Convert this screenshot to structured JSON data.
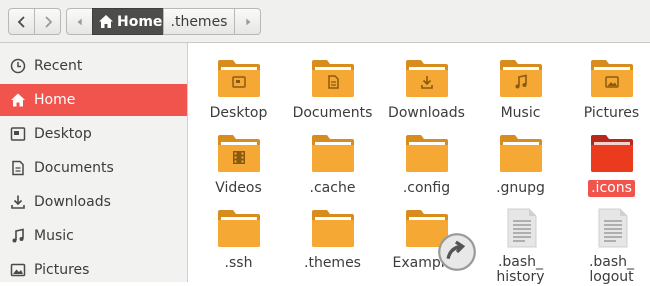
{
  "header": {
    "path": [
      {
        "label": "Home",
        "icon": "home-icon",
        "active": true
      },
      {
        "label": ".themes",
        "active": false
      }
    ]
  },
  "sidebar": {
    "items": [
      {
        "label": "Recent",
        "icon": "clock-icon"
      },
      {
        "label": "Home",
        "icon": "home-icon",
        "active": true
      },
      {
        "label": "Desktop",
        "icon": "desktop-icon"
      },
      {
        "label": "Documents",
        "icon": "document-icon"
      },
      {
        "label": "Downloads",
        "icon": "download-icon"
      },
      {
        "label": "Music",
        "icon": "music-icon"
      },
      {
        "label": "Pictures",
        "icon": "picture-icon"
      }
    ]
  },
  "files": [
    {
      "label": "Desktop",
      "type": "folder",
      "emblem": "desktop-icon"
    },
    {
      "label": "Documents",
      "type": "folder",
      "emblem": "document-icon"
    },
    {
      "label": "Downloads",
      "type": "folder",
      "emblem": "download-icon"
    },
    {
      "label": "Music",
      "type": "folder",
      "emblem": "music-icon"
    },
    {
      "label": "Pictures",
      "type": "folder",
      "emblem": "picture-icon"
    },
    {
      "label": "Videos",
      "type": "folder",
      "emblem": "film-icon"
    },
    {
      "label": ".cache",
      "type": "folder"
    },
    {
      "label": ".config",
      "type": "folder"
    },
    {
      "label": ".gnupg",
      "type": "folder"
    },
    {
      "label": ".icons",
      "type": "folder",
      "selected": true
    },
    {
      "label": ".ssh",
      "type": "folder"
    },
    {
      "label": ".themes",
      "type": "folder"
    },
    {
      "label": "Examples",
      "type": "folder-link"
    },
    {
      "label": ".bash_\nhistory",
      "type": "text-file"
    },
    {
      "label": ".bash_\nlogout",
      "type": "text-file"
    }
  ],
  "colors": {
    "accent": "#f0544c",
    "folder": "#f5a833",
    "folder_selected": "#ea3b1f",
    "path_active": "#4d4d4b"
  }
}
